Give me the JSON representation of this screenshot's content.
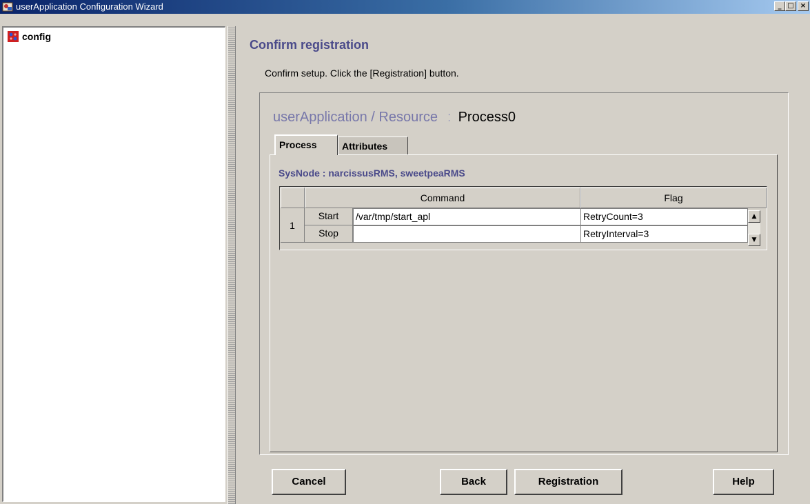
{
  "window": {
    "title": "userApplication Configuration Wizard",
    "controls": {
      "minimize": "_",
      "maximize": "□",
      "close": "×"
    }
  },
  "tree": {
    "items": [
      {
        "label": "config",
        "icon": "config-node-icon"
      }
    ]
  },
  "main": {
    "title": "Confirm registration",
    "instruction": "Confirm setup.  Click the [Registration] button.",
    "resource_label": "userApplication / Resource",
    "resource_separator": ":",
    "resource_value": "Process0",
    "tabs": [
      {
        "label": "Process",
        "active": true
      },
      {
        "label": "Attributes",
        "active": false
      }
    ],
    "sysnode": "SysNode : narcissusRMS, sweetpeaRMS",
    "table": {
      "headers": {
        "command": "Command",
        "flag": "Flag"
      },
      "rows": [
        {
          "index": "1",
          "start_label": "Start",
          "start_command": "/var/tmp/start_apl",
          "stop_label": "Stop",
          "stop_command": "",
          "flag1": "RetryCount=3",
          "flag2": "RetryInterval=3"
        }
      ]
    }
  },
  "buttons": {
    "cancel": "Cancel",
    "back": "Back",
    "registration": "Registration",
    "help": "Help"
  },
  "colors": {
    "title_bar": "#0a246a",
    "heading": "#4a4a8a",
    "face": "#d4d0c8"
  }
}
